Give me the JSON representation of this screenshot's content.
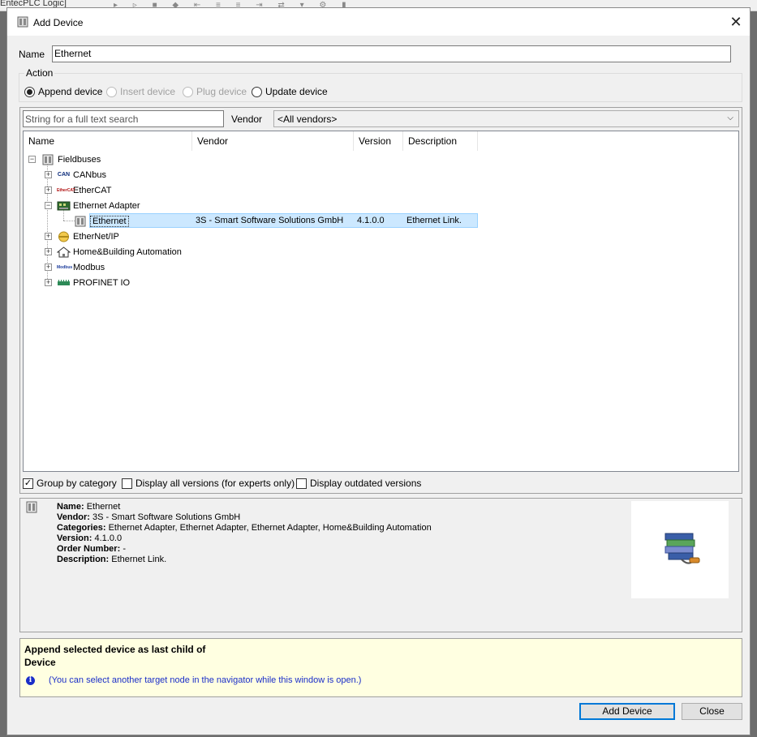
{
  "background_window": {
    "title": "EntecPLC Logic]"
  },
  "dialog": {
    "title": "Add Device",
    "close_glyph": "✕"
  },
  "name_field": {
    "label": "Name",
    "value": "Ethernet"
  },
  "action": {
    "legend": "Action",
    "options": [
      {
        "label": "Append device",
        "selected": true,
        "enabled": true
      },
      {
        "label": "Insert device",
        "selected": false,
        "enabled": false
      },
      {
        "label": "Plug device",
        "selected": false,
        "enabled": false
      },
      {
        "label": "Update device",
        "selected": false,
        "enabled": true
      }
    ]
  },
  "search": {
    "placeholder": "String for a full text search",
    "vendor_label": "Vendor",
    "vendor_value": "<All vendors>"
  },
  "columns": [
    "Name",
    "Vendor",
    "Version",
    "Description"
  ],
  "tree": [
    {
      "label": "Fieldbuses",
      "icon": "fieldbus-icon",
      "expander": "−"
    },
    {
      "label": "CANbus",
      "icon": "can-icon",
      "expander": "+"
    },
    {
      "label": "EtherCAT",
      "icon": "ethercat-icon",
      "expander": "+"
    },
    {
      "label": "Ethernet Adapter",
      "icon": "ethernet-adapter-icon",
      "expander": "−"
    },
    {
      "label": "Ethernet",
      "icon": "device-icon",
      "vendor": "3S - Smart Software Solutions GmbH",
      "version": "4.1.0.0",
      "description": "Ethernet Link."
    },
    {
      "label": "EtherNet/IP",
      "icon": "ethernetip-icon",
      "expander": "+"
    },
    {
      "label": "Home&Building Automation",
      "icon": "house-icon",
      "expander": "+"
    },
    {
      "label": "Modbus",
      "icon": "modbus-icon",
      "expander": "+"
    },
    {
      "label": "PROFINET IO",
      "icon": "profinet-icon",
      "expander": "+"
    }
  ],
  "icon_text": {
    "can": "CAN",
    "ethercat": "EtherCAT",
    "modbus": "Modbus"
  },
  "options": {
    "group_by_category": {
      "label": "Group by category",
      "checked": true
    },
    "display_all_versions": {
      "label": "Display all versions (for experts only)",
      "checked": false
    },
    "display_outdated": {
      "label": "Display outdated versions",
      "checked": false
    }
  },
  "info": {
    "name_label": "Name:",
    "name_value": "Ethernet",
    "vendor_label": "Vendor:",
    "vendor_value": "3S - Smart Software Solutions GmbH",
    "categories_label": "Categories:",
    "categories_value": "Ethernet Adapter, Ethernet Adapter, Ethernet Adapter, Home&Building Automation",
    "version_label": "Version:",
    "version_value": "4.1.0.0",
    "order_label": "Order Number:",
    "order_value": "-",
    "description_label": "Description:",
    "description_value": "Ethernet Link."
  },
  "note": {
    "line1": "Append selected device as last child of",
    "line2": "Device",
    "hint": "(You can select another target node in the navigator while this window is open.)",
    "info_glyph": "i"
  },
  "buttons": {
    "add": "Add Device",
    "close": "Close"
  },
  "colors": {
    "selection": "#cce8ff",
    "accent": "#0078d7",
    "hint_text": "#1a2ec8",
    "note_bg": "#ffffe1"
  }
}
